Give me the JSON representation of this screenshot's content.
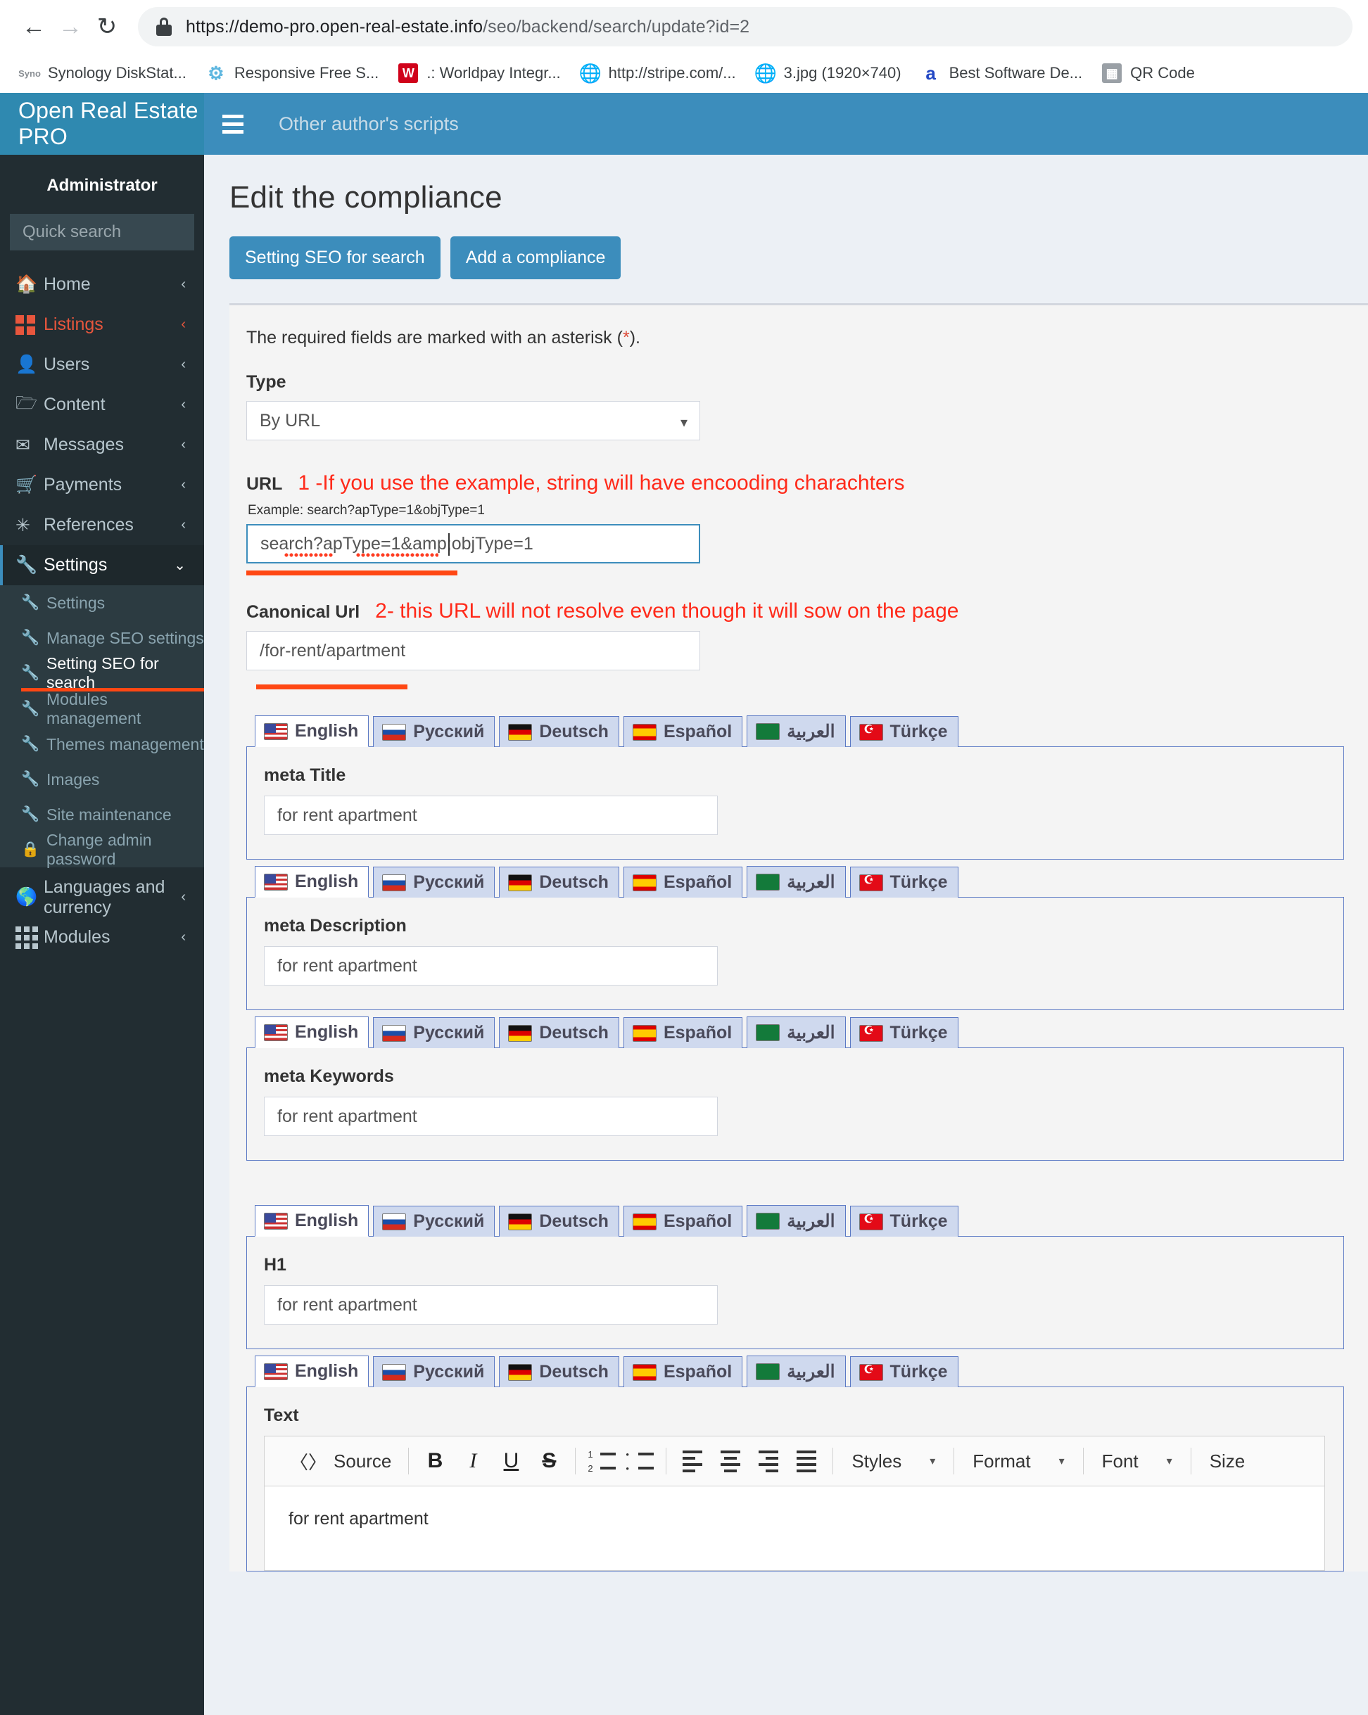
{
  "browser": {
    "back_icon": "back-arrow-icon",
    "forward_icon": "forward-arrow-icon",
    "reload_icon": "reload-icon",
    "url_prefix": "https://demo-pro.open-real-estate.info",
    "url_path": "/seo/backend/search/update?id=2",
    "bookmarks": [
      {
        "label": "Synology DiskStat...",
        "fav": "Syno"
      },
      {
        "label": "Responsive Free S...",
        "fav": "⚘"
      },
      {
        "label": ".: Worldpay Integr...",
        "fav": "W"
      },
      {
        "label": "http://stripe.com/...",
        "fav": "ἱ0"
      },
      {
        "label": "3.jpg (1920×740)",
        "fav": "ἱ0"
      },
      {
        "label": "Best Software De...",
        "fav": "a"
      },
      {
        "label": "QR Code",
        "fav": "▒"
      }
    ]
  },
  "sidebar": {
    "brand": "Open Real Estate PRO",
    "admin_label": "Administrator",
    "search_placeholder": "Quick search",
    "search_value": "",
    "search_icon": "search-icon",
    "items": [
      {
        "label": "Home",
        "icon": "home-icon",
        "caret": "‹"
      },
      {
        "label": "Listings",
        "icon": "grid-squares-icon",
        "caret": "‹"
      },
      {
        "label": "Users",
        "icon": "user-icon",
        "caret": "‹"
      },
      {
        "label": "Content",
        "icon": "folder-icon",
        "caret": "‹"
      },
      {
        "label": "Messages",
        "icon": "envelope-icon",
        "caret": "‹"
      },
      {
        "label": "Payments",
        "icon": "cart-icon",
        "caret": "‹"
      },
      {
        "label": "References",
        "icon": "asterisk-icon",
        "caret": "‹"
      },
      {
        "label": "Settings",
        "icon": "wrench-icon",
        "caret": "⌄"
      }
    ],
    "settings_submenu": [
      {
        "label": "Settings",
        "icon": "wrench-icon"
      },
      {
        "label": "Manage SEO settings",
        "icon": "wrench-icon"
      },
      {
        "label": "Setting SEO for search",
        "icon": "wrench-icon"
      },
      {
        "label": "Modules management",
        "icon": "wrench-icon"
      },
      {
        "label": "Themes management",
        "icon": "wrench-icon"
      },
      {
        "label": "Images",
        "icon": "wrench-icon"
      },
      {
        "label": "Site maintenance",
        "icon": "wrench-icon"
      },
      {
        "label": "Change admin password",
        "icon": "lock-icon"
      }
    ],
    "bottom_items": [
      {
        "label": "Languages and currency",
        "icon": "globe-icon",
        "caret": "‹"
      },
      {
        "label": "Modules",
        "icon": "dots-grid-icon",
        "caret": "‹"
      }
    ]
  },
  "topbar": {
    "menu_icon": "hamburger-icon",
    "link": "Other author's scripts"
  },
  "page": {
    "title": "Edit the compliance",
    "buttons": [
      {
        "label": "Setting SEO for search"
      },
      {
        "label": "Add a compliance"
      }
    ],
    "required_hint_before": "The required fields are marked with an asterisk (",
    "required_hint_ast": "*",
    "required_hint_after": ").",
    "type_label": "Type",
    "type_value": "By URL",
    "type_caret": "chevron-down-icon",
    "url_label": "URL",
    "url_annotation": "1 -If you use the example, string will have encooding charachters",
    "url_example": "Example: search?apType=1&objType=1",
    "url_value": "search?apType=1&amp;objType=1",
    "canonical_label": "Canonical Url",
    "canonical_annotation": "2- this URL will not resolve even though it will sow on the page",
    "canonical_value": "/for-rent/apartment"
  },
  "languages": [
    {
      "label": "English",
      "flag": "us"
    },
    {
      "label": "Русский",
      "flag": "ru"
    },
    {
      "label": "Deutsch",
      "flag": "de"
    },
    {
      "label": "Español",
      "flag": "es"
    },
    {
      "label": "العربية",
      "flag": "sa"
    },
    {
      "label": "Türkçe",
      "flag": "tr"
    }
  ],
  "fields": {
    "meta_title": {
      "label": "meta Title",
      "value": "for rent apartment"
    },
    "meta_description": {
      "label": "meta Description",
      "value": "for rent apartment"
    },
    "meta_keywords": {
      "label": "meta Keywords",
      "value": "for rent apartment"
    },
    "h1": {
      "label": "H1",
      "value": "for rent apartment"
    },
    "text": {
      "label": "Text",
      "value": "for rent apartment"
    }
  },
  "editor": {
    "source_label": "Source",
    "source_icon": "source-code-icon",
    "bold": "B",
    "italic": "I",
    "underline": "U",
    "strike": "S",
    "numbered_list_icon": "numbered-list-icon",
    "bullet_list_icon": "bullet-list-icon",
    "align_left_icon": "align-left-icon",
    "align_center_icon": "align-center-icon",
    "align_right_icon": "align-right-icon",
    "align_justify_icon": "align-justify-icon",
    "styles_label": "Styles",
    "format_label": "Format",
    "font_label": "Font",
    "size_label": "Size",
    "caret": "▾"
  }
}
